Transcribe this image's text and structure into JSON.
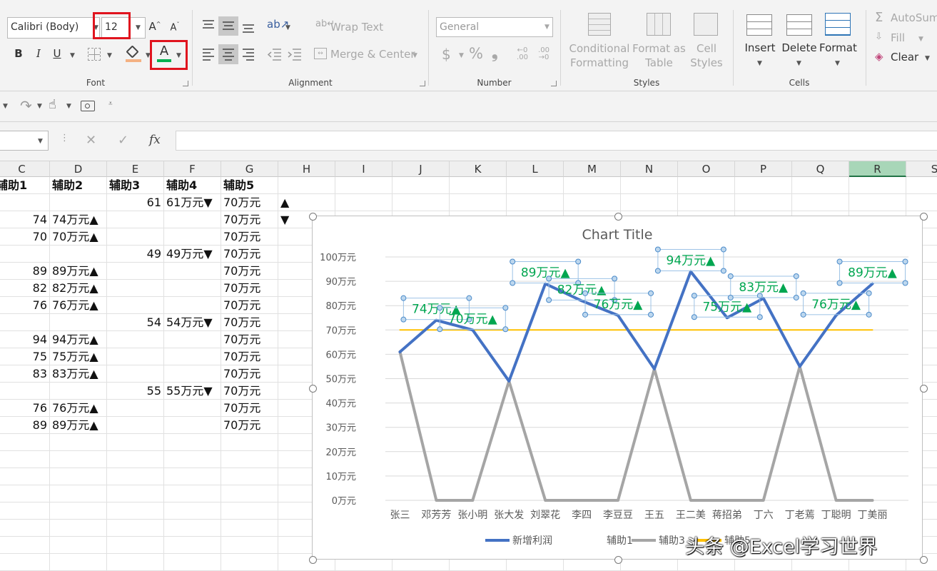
{
  "ribbon": {
    "font": {
      "group_label": "Font",
      "font_name": "Calibri (Body)",
      "font_size": "12",
      "bold": "B",
      "italic": "I",
      "underline": "U",
      "grow": "A",
      "shrink": "A",
      "font_color_letter": "A"
    },
    "alignment": {
      "group_label": "Alignment",
      "wrap_text": "Wrap Text",
      "merge_center": "Merge & Center"
    },
    "number": {
      "group_label": "Number",
      "format": "General",
      "currency": "$",
      "percent": "%",
      "comma": "❟",
      "inc_decimal": "←0 .00",
      "dec_decimal": ".00 →0"
    },
    "styles": {
      "group_label": "Styles",
      "conditional": "Conditional Formatting",
      "format_table": "Format as Table",
      "cell_styles": "Cell Styles"
    },
    "cells": {
      "group_label": "Cells",
      "insert": "Insert",
      "delete": "Delete",
      "format": "Format"
    },
    "editing": {
      "autosum": "AutoSum",
      "fill": "Fill",
      "clear": "Clear"
    }
  },
  "formula_bar": {
    "name_box": "",
    "fx": "fx",
    "cancel": "✕",
    "enter": "✓",
    "formula": ""
  },
  "columns": [
    "C",
    "D",
    "E",
    "F",
    "G",
    "H",
    "I",
    "J",
    "K",
    "L",
    "M",
    "N",
    "O",
    "P",
    "Q",
    "R",
    "S"
  ],
  "selected_column": "R",
  "sheet": {
    "headers": {
      "C": "辅助1",
      "D": "辅助2",
      "E": "辅助3",
      "F": "辅助4",
      "G": "辅助5"
    },
    "rows": [
      {
        "C": "",
        "D": "",
        "E": "61",
        "F": "61万元▼",
        "G": "70万元",
        "H": "▲"
      },
      {
        "C": "74",
        "D": "74万元▲",
        "E": "",
        "F": "",
        "G": "70万元",
        "H": "▼"
      },
      {
        "C": "70",
        "D": "70万元▲",
        "E": "",
        "F": "",
        "G": "70万元",
        "H": ""
      },
      {
        "C": "",
        "D": "",
        "E": "49",
        "F": "49万元▼",
        "G": "70万元",
        "H": ""
      },
      {
        "C": "89",
        "D": "89万元▲",
        "E": "",
        "F": "",
        "G": "70万元",
        "H": ""
      },
      {
        "C": "82",
        "D": "82万元▲",
        "E": "",
        "F": "",
        "G": "70万元",
        "H": ""
      },
      {
        "C": "76",
        "D": "76万元▲",
        "E": "",
        "F": "",
        "G": "70万元",
        "H": ""
      },
      {
        "C": "",
        "D": "",
        "E": "54",
        "F": "54万元▼",
        "G": "70万元",
        "H": ""
      },
      {
        "C": "94",
        "D": "94万元▲",
        "E": "",
        "F": "",
        "G": "70万元",
        "H": ""
      },
      {
        "C": "75",
        "D": "75万元▲",
        "E": "",
        "F": "",
        "G": "70万元",
        "H": ""
      },
      {
        "C": "83",
        "D": "83万元▲",
        "E": "",
        "F": "",
        "G": "70万元",
        "H": ""
      },
      {
        "C": "",
        "D": "",
        "E": "55",
        "F": "55万元▼",
        "G": "70万元",
        "H": ""
      },
      {
        "C": "76",
        "D": "76万元▲",
        "E": "",
        "F": "",
        "G": "70万元",
        "H": ""
      },
      {
        "C": "89",
        "D": "89万元▲",
        "E": "",
        "F": "",
        "G": "70万元",
        "H": ""
      }
    ]
  },
  "watermark": "头条 @Excel学习世界",
  "chart_data": {
    "type": "line",
    "title": "Chart Title",
    "categories": [
      "张三",
      "邓芳芳",
      "张小明",
      "张大发",
      "刘翠花",
      "李四",
      "李豆豆",
      "王五",
      "王二美",
      "蒋招弟",
      "丁六",
      "丁老蔫",
      "丁聪明",
      "丁美丽"
    ],
    "y_ticks": [
      "0万元",
      "10万元",
      "20万元",
      "30万元",
      "40万元",
      "50万元",
      "60万元",
      "70万元",
      "80万元",
      "90万元",
      "100万元"
    ],
    "ylim": [
      0,
      100
    ],
    "series": [
      {
        "name": "新增利润",
        "color": "#4472c4",
        "values": [
          61,
          74,
          70,
          49,
          89,
          82,
          76,
          54,
          94,
          75,
          83,
          55,
          76,
          89
        ]
      },
      {
        "name": "辅助1",
        "color": "#ed7d31",
        "values": []
      },
      {
        "name": "辅助3",
        "color": "#a5a5a5",
        "values": [
          61,
          0,
          0,
          49,
          0,
          0,
          0,
          54,
          0,
          0,
          0,
          55,
          0,
          0
        ]
      },
      {
        "name": "辅助5",
        "color": "#ffc000",
        "values": [
          70,
          70,
          70,
          70,
          70,
          70,
          70,
          70,
          70,
          70,
          70,
          70,
          70,
          70
        ]
      }
    ],
    "legend": [
      "新增利润",
      "辅助1",
      "辅助3",
      "辅助5"
    ],
    "legend_position": "bottom",
    "data_labels": [
      {
        "category": "邓芳芳",
        "value": 74,
        "text": "74万元▲"
      },
      {
        "category": "张小明",
        "value": 70,
        "text": "70万元▲"
      },
      {
        "category": "刘翠花",
        "value": 89,
        "text": "89万元▲"
      },
      {
        "category": "李四",
        "value": 82,
        "text": "82万元▲"
      },
      {
        "category": "李豆豆",
        "value": 76,
        "text": "76万元▲"
      },
      {
        "category": "王二美",
        "value": 94,
        "text": "94万元▲"
      },
      {
        "category": "蒋招弟",
        "value": 75,
        "text": "75万元▲"
      },
      {
        "category": "丁六",
        "value": 83,
        "text": "83万元▲"
      },
      {
        "category": "丁聪明",
        "value": 76,
        "text": "76万元▲"
      },
      {
        "category": "丁美丽",
        "value": 89,
        "text": "89万元▲"
      }
    ],
    "label_color": "#00a650",
    "grid": true
  }
}
